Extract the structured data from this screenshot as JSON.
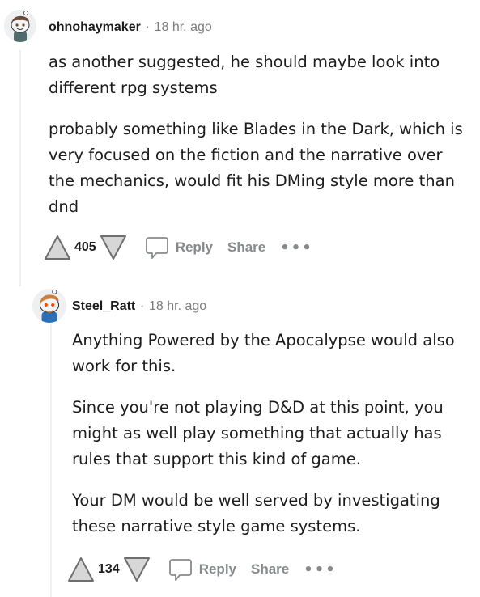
{
  "comments": [
    {
      "username": "ohnohaymaker",
      "separator": "·",
      "time": "18 hr. ago",
      "paragraphs": [
        "as another suggested, he should maybe look into different rpg systems",
        "probably something like Blades in the Dark, which is very focused on the fiction and the narrative over the mechanics, would fit his DMing style more than dnd"
      ],
      "score": "405",
      "reply_label": "Reply",
      "share_label": "Share",
      "more_label": "•••",
      "avatar_colors": {
        "hair": "#6b4a3a",
        "shirt": "#4f6b6b",
        "face": "#f4f4f4"
      }
    },
    {
      "username": "Steel_Ratt",
      "separator": "·",
      "time": "18 hr. ago",
      "paragraphs": [
        "Anything Powered by the Apocalypse would also work for this.",
        "Since you're not playing D&D at this point, you might as well play something that actually has rules that support this kind of game.",
        "Your DM would be well served by investigating these narrative style game systems."
      ],
      "score": "134",
      "reply_label": "Reply",
      "share_label": "Share",
      "more_label": "•••",
      "avatar_colors": {
        "hair": "#c9803e",
        "shirt": "#2a6fb8",
        "face": "#f4f4f4",
        "eyes": "#ff4500"
      }
    }
  ],
  "icons": {
    "upvote": "upvote-arrow-icon",
    "downvote": "downvote-arrow-icon",
    "reply": "speech-bubble-icon"
  }
}
